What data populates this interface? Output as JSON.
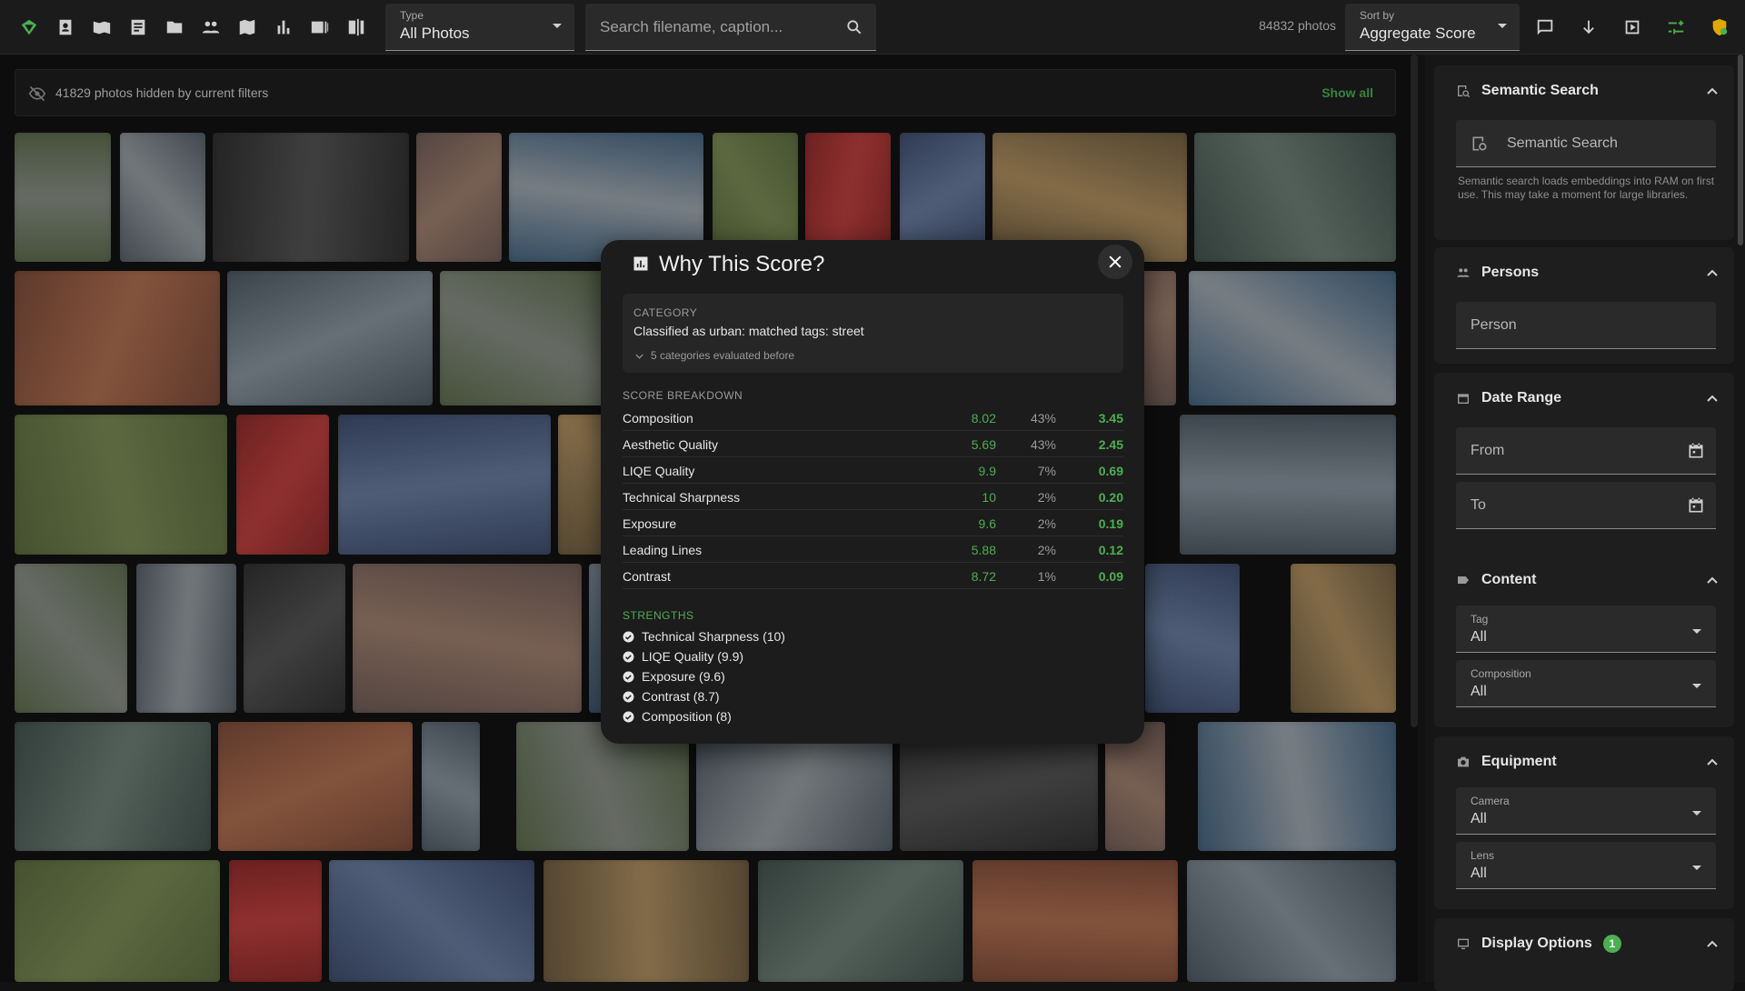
{
  "toolbar": {
    "type_label": "Type",
    "type_value": "All Photos",
    "search_placeholder": "Search filename, caption...",
    "photo_count": "84832 photos",
    "sort_label": "Sort by",
    "sort_value": "Aggregate Score"
  },
  "filters_bar": {
    "hidden_text": "41829 photos hidden by current filters",
    "show_all": "Show all"
  },
  "sidebar": {
    "semantic": {
      "title": "Semantic Search",
      "placeholder": "Semantic Search",
      "hint": "Semantic search loads embeddings into RAM on first use. This may take a moment for large libraries."
    },
    "persons": {
      "title": "Persons",
      "placeholder": "Person"
    },
    "date_range": {
      "title": "Date Range",
      "from": "From",
      "to": "To"
    },
    "content": {
      "title": "Content",
      "tag_label": "Tag",
      "tag_value": "All",
      "composition_label": "Composition",
      "composition_value": "All"
    },
    "equipment": {
      "title": "Equipment",
      "camera_label": "Camera",
      "camera_value": "All",
      "lens_label": "Lens",
      "lens_value": "All"
    },
    "display": {
      "title": "Display Options",
      "badge": "1"
    }
  },
  "modal": {
    "title": "Why This Score?",
    "category_label": "CATEGORY",
    "category_value": "Classified as urban: matched tags: street",
    "category_expand": "5 categories evaluated before",
    "breakdown_label": "SCORE BREAKDOWN",
    "rows": [
      {
        "name": "Composition",
        "score": "8.02",
        "weight": "43%",
        "contrib": "3.45"
      },
      {
        "name": "Aesthetic Quality",
        "score": "5.69",
        "weight": "43%",
        "contrib": "2.45"
      },
      {
        "name": "LIQE Quality",
        "score": "9.9",
        "weight": "7%",
        "contrib": "0.69"
      },
      {
        "name": "Technical Sharpness",
        "score": "10",
        "weight": "2%",
        "contrib": "0.20"
      },
      {
        "name": "Exposure",
        "score": "9.6",
        "weight": "2%",
        "contrib": "0.19"
      },
      {
        "name": "Leading Lines",
        "score": "5.88",
        "weight": "2%",
        "contrib": "0.12"
      },
      {
        "name": "Contrast",
        "score": "8.72",
        "weight": "1%",
        "contrib": "0.09"
      }
    ],
    "strengths_label": "STRENGTHS",
    "strengths": [
      "Technical Sharpness (10)",
      "LIQE Quality (9.9)",
      "Exposure (9.6)",
      "Contrast (8.7)",
      "Composition (8)"
    ]
  },
  "colors": {
    "accent": "#4caf50",
    "background": "#121212",
    "surface": "#1e1e1e"
  }
}
